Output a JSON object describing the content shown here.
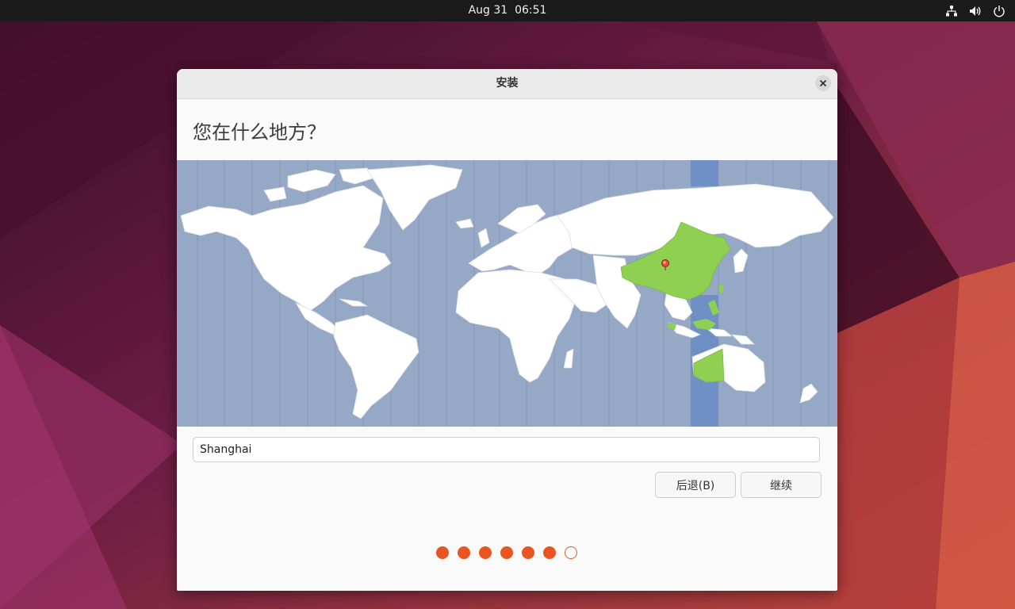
{
  "topbar": {
    "date": "Aug 31",
    "time": "06:51",
    "icons": [
      "network-icon",
      "volume-icon",
      "power-icon"
    ]
  },
  "window": {
    "title": "安装",
    "heading": "您在什么地方？",
    "timezone_input": {
      "value": "Shanghai"
    },
    "buttons": {
      "back_label": "后退(B)",
      "continue_label": "继续"
    },
    "progress": {
      "total_steps": 7,
      "completed_steps": 6
    },
    "map": {
      "selected_country": "China",
      "highlight_color": "#8fcf52",
      "selected_timezone_band_color": "#6e90c5",
      "ocean_color": "#95a8c6",
      "land_color": "#ffffff"
    }
  },
  "colors": {
    "accent": "#e95420"
  }
}
